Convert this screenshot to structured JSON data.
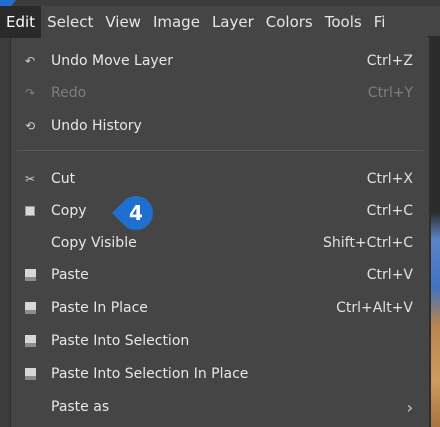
{
  "menubar": {
    "items": [
      "Edit",
      "Select",
      "View",
      "Image",
      "Layer",
      "Colors",
      "Tools",
      "Fi"
    ]
  },
  "menu": {
    "undo_move_layer": {
      "label": "Undo Move Layer",
      "shortcut": "Ctrl+Z",
      "icon": "undo-icon"
    },
    "redo": {
      "label": "Redo",
      "shortcut": "Ctrl+Y",
      "icon": "redo-icon"
    },
    "undo_history": {
      "label": "Undo History",
      "icon": "history-icon"
    },
    "cut": {
      "label": "Cut",
      "shortcut": "Ctrl+X",
      "icon": "scissors-icon"
    },
    "copy": {
      "label": "Copy",
      "shortcut": "Ctrl+C",
      "icon": "copy-icon"
    },
    "copy_visible": {
      "label": "Copy Visible",
      "shortcut": "Shift+Ctrl+C"
    },
    "paste": {
      "label": "Paste",
      "shortcut": "Ctrl+V",
      "icon": "paste-icon"
    },
    "paste_in_place": {
      "label": "Paste In Place",
      "shortcut": "Ctrl+Alt+V",
      "icon": "paste-icon"
    },
    "paste_into_selection": {
      "label": "Paste Into Selection",
      "icon": "paste-icon"
    },
    "paste_into_selection_in_place": {
      "label": "Paste Into Selection In Place",
      "icon": "paste-icon"
    },
    "paste_as": {
      "label": "Paste as",
      "icon": "chevron-right-icon"
    }
  },
  "callout": {
    "number": "4",
    "color": "#1f6fcf"
  }
}
